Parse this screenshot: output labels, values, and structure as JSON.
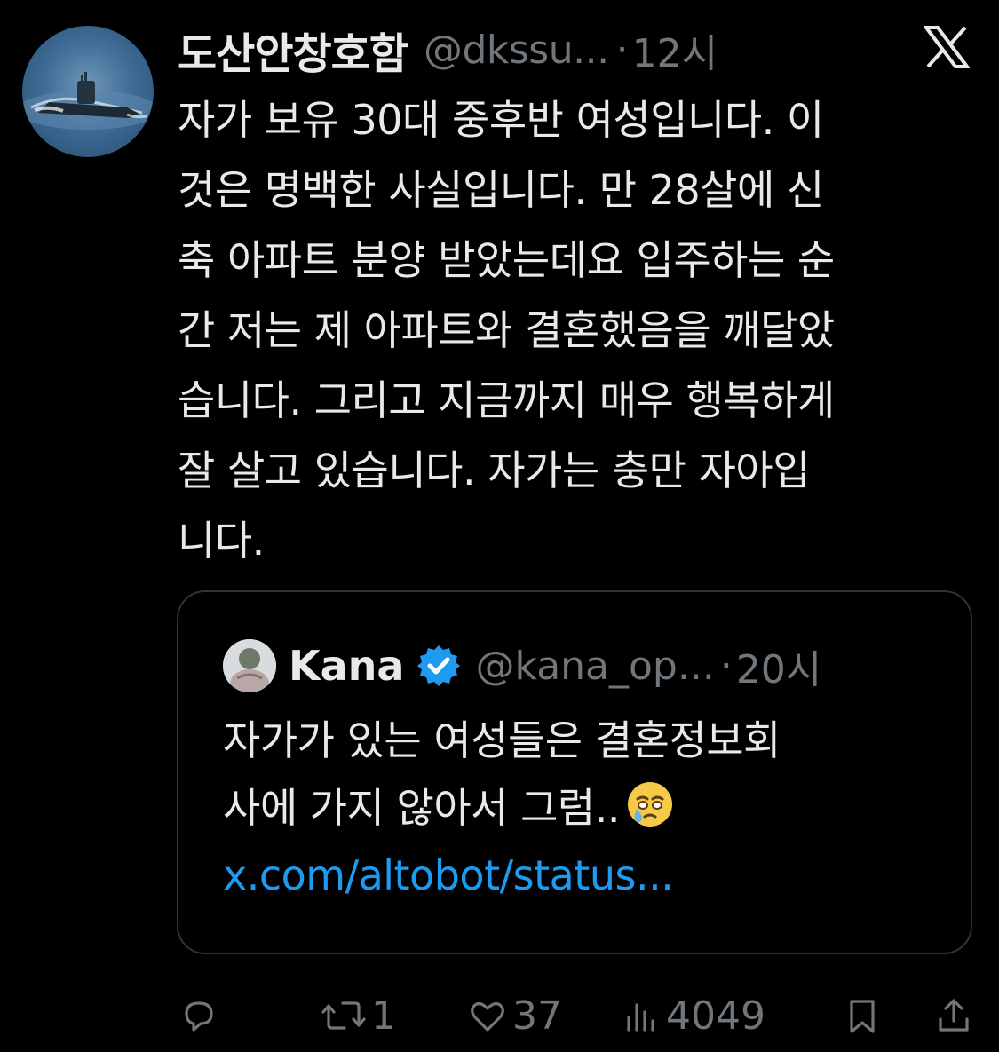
{
  "tweet": {
    "display_name": "도산안창호함",
    "handle": "@dkssu...",
    "separator": "·",
    "time": "12시",
    "text": "자가 보유 30대 중후반 여성입니다. 이\n것은 명백한 사실입니다. 만 28살에 신\n축 아파트 분양 받았는데요 입주하는 순\n간 저는 제 아파트와 결혼했음을 깨달았\n습니다. 그리고 지금까지 매우 행복하게\n잘 살고 있습니다. 자가는 충만 자아입\n니다."
  },
  "quoted": {
    "display_name": "Kana",
    "handle": "@kana_op...",
    "separator": "·",
    "time": "20시",
    "text_line1": "자가가 있는 여성들은 결혼정보회",
    "text_line2": "사에 가지 않아서 그럼..",
    "emoji": "face-holding-back-tears",
    "link": "x.com/altobot/status..."
  },
  "actions": {
    "replies": "",
    "reposts": "1",
    "likes": "37",
    "views": "4049"
  },
  "colors": {
    "background": "#000000",
    "text": "#e7e9ea",
    "muted": "#71767b",
    "link": "#1d9bf0",
    "border": "#2f3336",
    "verified": "#1d9bf0"
  }
}
